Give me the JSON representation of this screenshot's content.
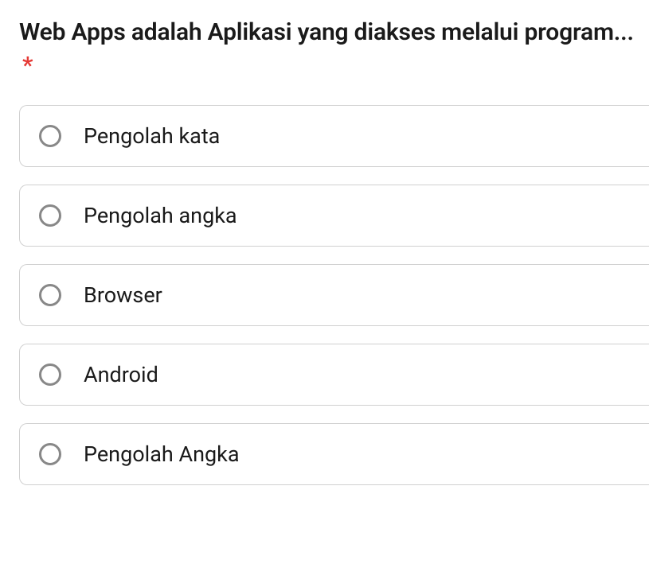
{
  "question": {
    "text": "Web Apps adalah Aplikasi yang diakses melalui program...",
    "required": true,
    "required_mark": "*"
  },
  "options": [
    {
      "label": "Pengolah kata"
    },
    {
      "label": "Pengolah angka"
    },
    {
      "label": "Browser"
    },
    {
      "label": "Android"
    },
    {
      "label": "Pengolah Angka"
    }
  ]
}
